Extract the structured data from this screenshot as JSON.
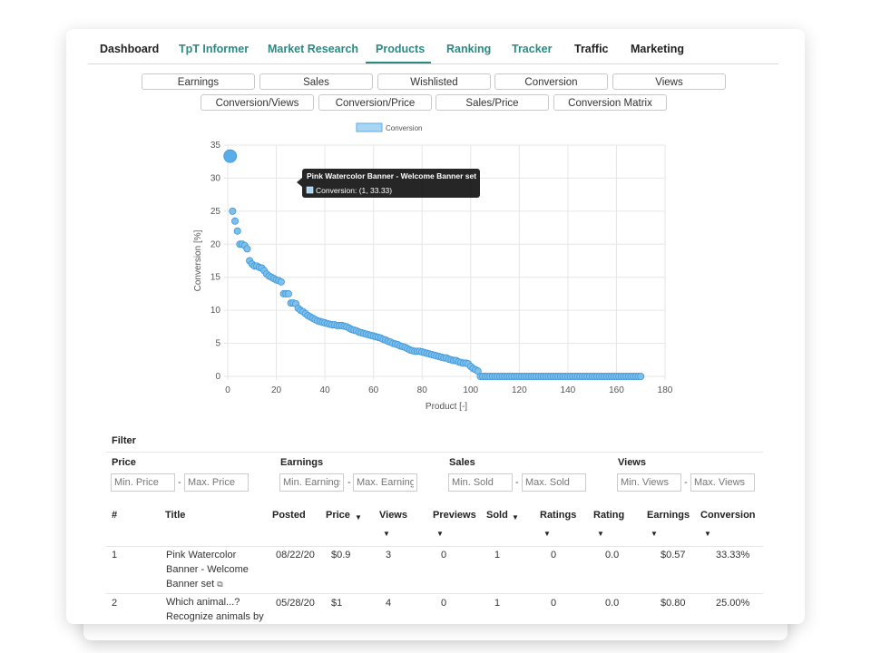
{
  "nav": {
    "items": [
      {
        "label": "Dashboard",
        "style": "dark"
      },
      {
        "label": "TpT Informer",
        "style": "teal"
      },
      {
        "label": "Market Research",
        "style": "teal"
      },
      {
        "label": "Products",
        "style": "teal",
        "active": true
      },
      {
        "label": "Ranking",
        "style": "teal"
      },
      {
        "label": "Tracker",
        "style": "teal"
      },
      {
        "label": "Traffic",
        "style": "dark"
      },
      {
        "label": "Marketing",
        "style": "dark"
      }
    ],
    "accent": "#2a8a83"
  },
  "metric_buttons": {
    "row1": [
      "Earnings",
      "Sales",
      "Wishlisted",
      "Conversion",
      "Views"
    ],
    "row2": [
      "Conversion/Views",
      "Conversion/Price",
      "Sales/Price",
      "Conversion Matrix"
    ]
  },
  "tooltip": {
    "title": "Pink Watercolor Banner - Welcome Banner set",
    "text": "Conversion: (1, 33.33)"
  },
  "chart_data": {
    "type": "scatter",
    "legend": "Conversion",
    "legend_position": "top",
    "xlabel": "Product [-]",
    "ylabel": "Conversion [%]",
    "xlim": [
      0,
      180
    ],
    "ylim": [
      0,
      35
    ],
    "xticks": [
      0,
      20,
      40,
      60,
      80,
      100,
      120,
      140,
      160,
      180
    ],
    "yticks": [
      0,
      5,
      10,
      15,
      20,
      25,
      30,
      35
    ],
    "grid": true,
    "color": "#5aaee8",
    "highlighted_point": {
      "x": 1,
      "y": 33.33
    },
    "series": [
      {
        "name": "Conversion",
        "y": [
          33.33,
          25.0,
          23.5,
          22.0,
          20.0,
          20.0,
          19.8,
          19.3,
          17.5,
          17.0,
          16.7,
          16.7,
          16.5,
          16.4,
          16.0,
          15.5,
          15.2,
          15.0,
          14.8,
          14.6,
          14.5,
          14.3,
          12.5,
          12.5,
          12.5,
          11.1,
          11.1,
          11.0,
          10.3,
          10.0,
          9.8,
          9.5,
          9.2,
          9.0,
          8.8,
          8.6,
          8.4,
          8.3,
          8.2,
          8.1,
          8.0,
          7.9,
          7.8,
          7.8,
          7.7,
          7.7,
          7.7,
          7.6,
          7.5,
          7.3,
          7.1,
          7.0,
          6.9,
          6.7,
          6.6,
          6.5,
          6.4,
          6.3,
          6.2,
          6.1,
          6.0,
          5.9,
          5.8,
          5.6,
          5.5,
          5.3,
          5.2,
          5.0,
          4.9,
          4.8,
          4.6,
          4.5,
          4.4,
          4.2,
          4.0,
          3.9,
          3.8,
          3.8,
          3.8,
          3.7,
          3.6,
          3.5,
          3.4,
          3.3,
          3.2,
          3.1,
          3.0,
          2.9,
          2.8,
          2.8,
          2.6,
          2.5,
          2.4,
          2.4,
          2.2,
          2.1,
          2.0,
          2.0,
          1.9,
          1.5,
          1.2,
          1.0,
          0.8,
          0,
          0,
          0,
          0,
          0,
          0,
          0,
          0,
          0,
          0,
          0,
          0,
          0,
          0,
          0,
          0,
          0,
          0,
          0,
          0,
          0,
          0,
          0,
          0,
          0,
          0,
          0,
          0,
          0,
          0,
          0,
          0,
          0,
          0,
          0,
          0,
          0,
          0,
          0,
          0,
          0,
          0,
          0,
          0,
          0,
          0,
          0,
          0,
          0,
          0,
          0,
          0,
          0,
          0,
          0,
          0,
          0,
          0,
          0,
          0,
          0,
          0,
          0,
          0,
          0,
          0,
          0
        ]
      }
    ]
  },
  "filter": {
    "title": "Filter",
    "groups": [
      {
        "label": "Price",
        "min_placeholder": "Min. Price",
        "max_placeholder": "Max. Price"
      },
      {
        "label": "Earnings",
        "min_placeholder": "Min. Earnings",
        "max_placeholder": "Max. Earnings"
      },
      {
        "label": "Sales",
        "min_placeholder": "Min. Sold",
        "max_placeholder": "Max. Sold"
      },
      {
        "label": "Views",
        "min_placeholder": "Min. Views",
        "max_placeholder": "Max. Views"
      }
    ],
    "dash": "-"
  },
  "table": {
    "headers": {
      "num": "#",
      "title": "Title",
      "posted": "Posted",
      "price": "Price",
      "views": "Views",
      "previews": "Previews",
      "sold": "Sold",
      "ratings": "Ratings",
      "rating": "Rating",
      "earnings": "Earnings",
      "conversion": "Conversion"
    },
    "sort_icon": "▼",
    "rows": [
      {
        "num": "1",
        "title": "Pink Watercolor Banner - Welcome Banner set",
        "title_lines": [
          "Pink Watercolor",
          "Banner - Welcome",
          "Banner set"
        ],
        "link_icon": "⧉",
        "posted": "08/22/20",
        "price": "$0.9",
        "views": "3",
        "previews": "0",
        "sold": "1",
        "ratings": "0",
        "rating": "0.0",
        "earnings": "$0.57",
        "conversion": "33.33%"
      },
      {
        "num": "2",
        "title": "Which animal...? Recognize animals by",
        "title_lines": [
          "Which animal...?",
          "Recognize animals by"
        ],
        "posted": "05/28/20",
        "price": "$1",
        "views": "4",
        "previews": "0",
        "sold": "1",
        "ratings": "0",
        "rating": "0.0",
        "earnings": "$0.80",
        "conversion": "25.00%"
      }
    ]
  }
}
